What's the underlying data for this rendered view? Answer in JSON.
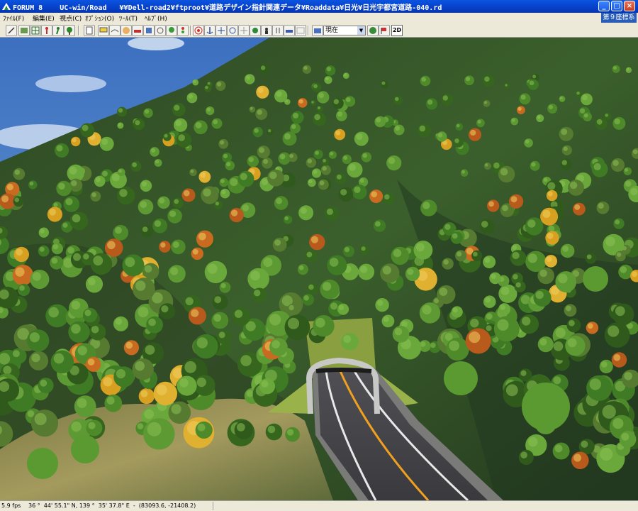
{
  "window": {
    "app_name": "FORUM 8",
    "title": "UC-win/Road   ¥¥Dell-road2¥ftproot¥道路デザイン指針関連データ¥Roaddata¥日光¥日光宇都宮道路-040.rd",
    "controls": {
      "minimize": "_",
      "maximize": "□",
      "close": "×"
    }
  },
  "menu": {
    "items": [
      "ﾌｧｲﾙ(F)",
      "編集(E)",
      "視点(C)",
      "ｵﾌﾟｼｮﾝ(O)",
      "ﾂｰﾙ(T)",
      "ﾍﾙﾌﾟ(H)"
    ],
    "coordinate_system": "第９座標系"
  },
  "toolbar": {
    "view_select_value": "現在",
    "button_2d_label": "2D"
  },
  "status": {
    "fps": "5.9 fps",
    "coordinates": "36 °  44' 55.1\" N, 139 °  35' 37.8\" E  -  (83093.6, -21408.2)"
  },
  "colors": {
    "title_bar": "#0740c8",
    "menu_bg": "#ece9d8",
    "sky": "#4a80c8",
    "foliage": "#3e6a20",
    "road": "#4a4a4e",
    "center_line": "#f0a020"
  }
}
